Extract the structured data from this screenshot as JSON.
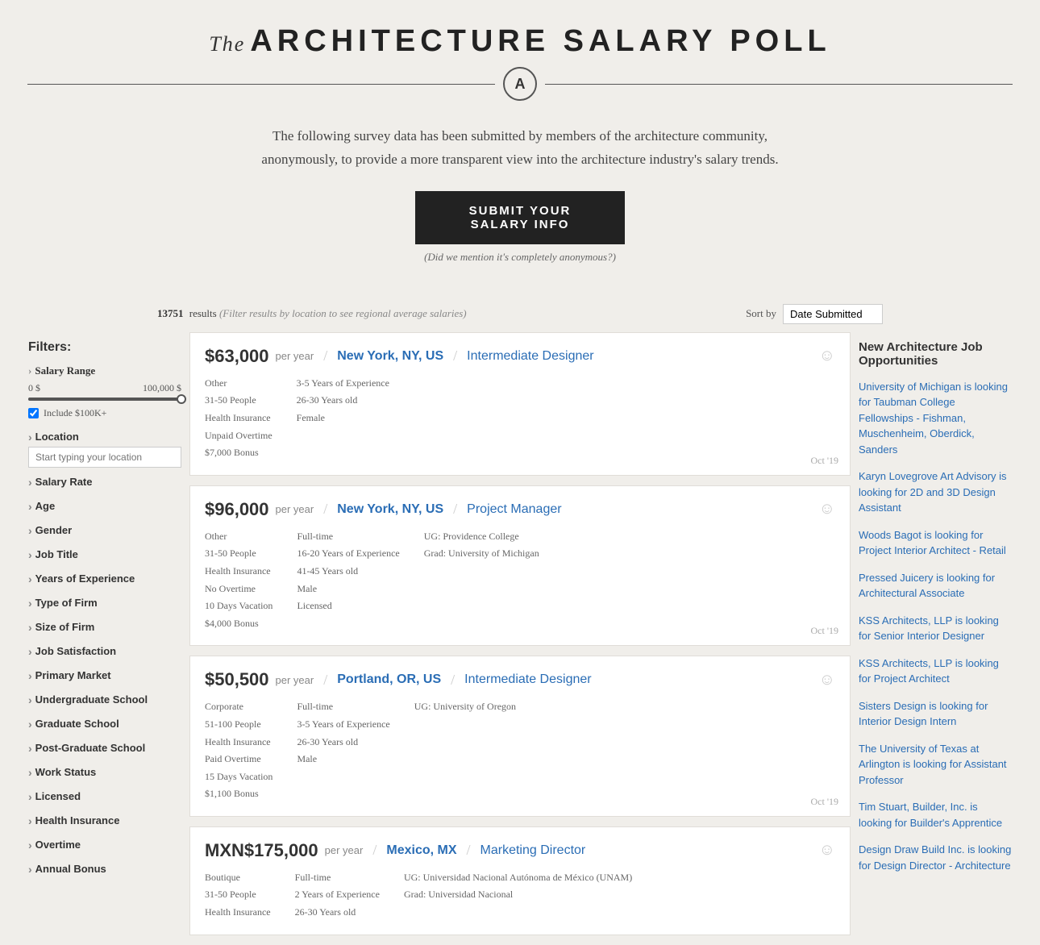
{
  "header": {
    "the_label": "The",
    "title": "ARCHITECTURE SALARY POLL",
    "logo_letter": "A"
  },
  "intro": {
    "text": "The following survey data has been submitted by members of the architecture community, anonymously, to provide a more transparent view into the architecture industry's salary trends.",
    "submit_button": "SUBMIT YOUR SALARY INFO",
    "anon_note": "(Did we mention it's completely anonymous?)"
  },
  "results": {
    "count": "13751",
    "hint": "(Filter results by location to see regional average salaries)",
    "sort_label": "Sort by",
    "sort_value": "Date Submitted"
  },
  "filters": {
    "title": "Filters:",
    "salary_range": {
      "label": "Salary Range",
      "min": "0 $",
      "max": "100,000 $",
      "include_label": "Include $100K+"
    },
    "location_label": "Location",
    "location_placeholder": "Start typing your location",
    "groups": [
      "Salary Rate",
      "Age",
      "Gender",
      "Job Title",
      "Years of Experience",
      "Type of Firm",
      "Size of Firm",
      "Job Satisfaction",
      "Primary Market",
      "Undergraduate School",
      "Graduate School",
      "Post-Graduate School",
      "Work Status",
      "Licensed",
      "Health Insurance",
      "Overtime",
      "Annual Bonus"
    ]
  },
  "listings": [
    {
      "salary": "$63,000",
      "per_year": "per year",
      "location": "New York, NY, US",
      "job_title": "Intermediate Designer",
      "col1": [
        "Other",
        "31-50 People",
        "Health Insurance",
        "Unpaid Overtime",
        "$7,000 Bonus"
      ],
      "col2": [
        "3-5 Years of Experience",
        "26-30 Years old",
        "Female"
      ],
      "col3": [],
      "date": "Oct '19"
    },
    {
      "salary": "$96,000",
      "per_year": "per year",
      "location": "New York, NY, US",
      "job_title": "Project Manager",
      "col1": [
        "Other",
        "31-50 People",
        "Health Insurance",
        "No Overtime",
        "10 Days Vacation",
        "$4,000 Bonus"
      ],
      "col2": [
        "Full-time",
        "16-20 Years of Experience",
        "41-45 Years old",
        "Male",
        "Licensed"
      ],
      "col3": [
        "UG: Providence College",
        "Grad: University of Michigan"
      ],
      "date": "Oct '19"
    },
    {
      "salary": "$50,500",
      "per_year": "per year",
      "location": "Portland, OR, US",
      "job_title": "Intermediate Designer",
      "col1": [
        "Corporate",
        "51-100 People",
        "Health Insurance",
        "Paid Overtime",
        "15 Days Vacation",
        "$1,100 Bonus"
      ],
      "col2": [
        "Full-time",
        "3-5 Years of Experience",
        "26-30 Years old",
        "Male"
      ],
      "col3": [
        "UG: University of Oregon"
      ],
      "date": "Oct '19"
    },
    {
      "salary": "MXN$175,000",
      "per_year": "per year",
      "location": "Mexico, MX",
      "job_title": "Marketing Director",
      "col1": [
        "Boutique",
        "31-50 People",
        "Health Insurance"
      ],
      "col2": [
        "Full-time",
        "2 Years of Experience",
        "26-30 Years old"
      ],
      "col3": [
        "UG: Universidad Nacional Autónoma de México (UNAM)",
        "Grad: Universidad Nacional"
      ],
      "date": ""
    }
  ],
  "jobs": {
    "title": "New Architecture Job Opportunities",
    "listings": [
      "University of Michigan is looking for Taubman College Fellowships - Fishman, Muschenheim, Oberdick, Sanders",
      "Karyn Lovegrove Art Advisory is looking for 2D and 3D Design Assistant",
      "Woods Bagot is looking for Project Interior Architect - Retail",
      "Pressed Juicery is looking for Architectural Associate",
      "KSS Architects, LLP is looking for Senior Interior Designer",
      "KSS Architects, LLP is looking for Project Architect",
      "Sisters Design is looking for Interior Design Intern",
      "The University of Texas at Arlington is looking for Assistant Professor",
      "Tim Stuart, Builder, Inc. is looking for Builder's Apprentice",
      "Design Draw Build Inc. is looking for Design Director - Architecture"
    ]
  }
}
